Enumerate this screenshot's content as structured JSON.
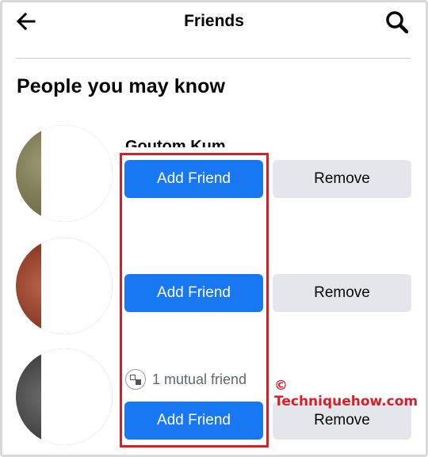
{
  "header": {
    "title": "Friends",
    "back_icon": "arrow-left-icon",
    "search_icon": "search-icon"
  },
  "section": {
    "title": "People you may know"
  },
  "suggestions": [
    {
      "name_visible": "Goutom Kum",
      "mutual_text": "",
      "add_label": "Add Friend",
      "remove_label": "Remove"
    },
    {
      "name_visible": "",
      "mutual_text": "",
      "add_label": "Add Friend",
      "remove_label": "Remove"
    },
    {
      "name_visible": "",
      "mutual_text": "1 mutual friend",
      "add_label": "Add Friend",
      "remove_label": "Remove"
    }
  ],
  "watermark": "© Techniquehow.com",
  "colors": {
    "primary": "#1877f2",
    "secondary_button": "#e4e6eb",
    "highlight": "#d42028"
  }
}
